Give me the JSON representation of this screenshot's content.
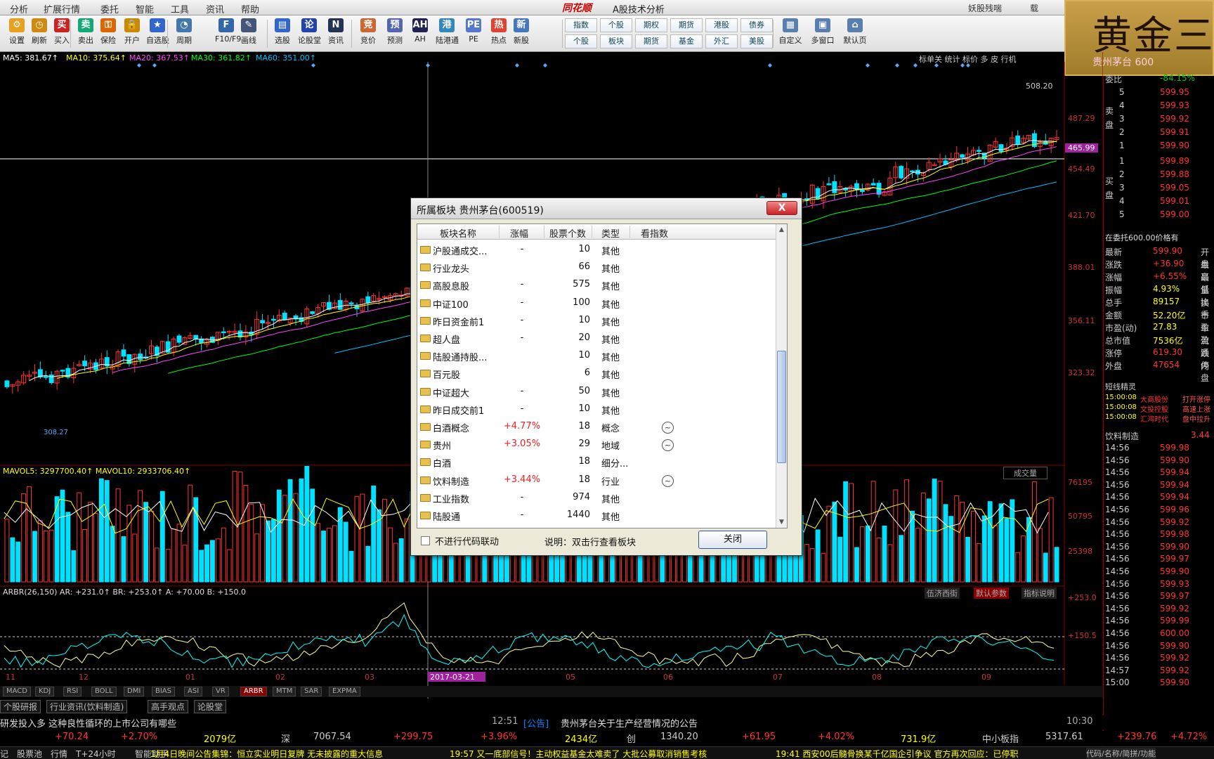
{
  "menu": {
    "items": [
      "分析",
      "扩展行情",
      "委托",
      "智能",
      "工具",
      "资讯",
      "帮助"
    ],
    "brand": "同花顺",
    "app_title": "A股技术分析",
    "right_items": [
      "妖股残喘",
      "载"
    ]
  },
  "toolbar": {
    "buttons": [
      {
        "label": "设置",
        "icon": "gear-icon"
      },
      {
        "label": "刷新",
        "icon": "clock-icon"
      },
      {
        "label": "买入",
        "icon": "buy-icon"
      },
      {
        "label": "卖出",
        "icon": "sell-icon"
      },
      {
        "label": "保险",
        "icon": "key-icon"
      },
      {
        "label": "开户",
        "icon": "lock-icon"
      },
      {
        "label": "自选股",
        "icon": "star-icon"
      },
      {
        "label": "周期",
        "icon": "period-icon"
      },
      {
        "label": "F10/F9",
        "icon": "f10-icon"
      },
      {
        "label": "画线",
        "icon": "pen-icon"
      },
      {
        "label": "选股",
        "icon": "chart-icon"
      },
      {
        "label": "论股堂",
        "icon": "talk-icon"
      },
      {
        "label": "资讯",
        "icon": "news-icon"
      },
      {
        "label": "竞价",
        "icon": "bid-icon"
      },
      {
        "label": "预测",
        "icon": "forecast-icon"
      },
      {
        "label": "AH",
        "icon": "ah-icon"
      },
      {
        "label": "陆港通",
        "icon": "hk-connect-icon"
      },
      {
        "label": "PE",
        "icon": "pe-icon"
      },
      {
        "label": "热点",
        "icon": "hot-icon"
      },
      {
        "label": "新股",
        "icon": "new-stock-icon"
      }
    ],
    "grid_buttons": [
      {
        "top": "指数",
        "bottom": "个股"
      },
      {
        "top": "个股",
        "bottom": "板块"
      },
      {
        "top": "期权",
        "bottom": "期货"
      },
      {
        "top": "期货",
        "bottom": "基金"
      },
      {
        "top": "港股",
        "bottom": "外汇"
      },
      {
        "top": "债券",
        "bottom": "美股"
      }
    ],
    "right_buttons": [
      {
        "label": "自定义",
        "icon": "custom-icon"
      },
      {
        "label": "多窗口",
        "icon": "window-icon"
      },
      {
        "label": "默认页",
        "icon": "home-icon"
      }
    ]
  },
  "gold_overlay": {
    "title": "黄金三",
    "sub": "贵州茅台 600"
  },
  "chart": {
    "ma_labels": [
      {
        "text": "MA5: 381.67↑",
        "color": "#ffffff"
      },
      {
        "text": "MA10: 375.64↑",
        "color": "#ffff00"
      },
      {
        "text": "MA20: 367.53↑",
        "color": "#ff44ff"
      },
      {
        "text": "MA30: 361.82↑",
        "color": "#00ff00"
      },
      {
        "text": "MA60: 351.00↑",
        "color": "#00c0ff"
      }
    ],
    "vol_label": "MAVOL5: 3297700.40↑  MAVOL10: 2933706.40↑",
    "arbr_label": "ARBR(26,150) AR: +231.0↑  BR: +253.0↑  A: +70.00  B: +150.0",
    "price_axis": [
      "508.20",
      "487.29",
      "465.99",
      "454.49",
      "421.70",
      "388.01",
      "356.11",
      "323.32"
    ],
    "vol_axis": [
      "76195",
      "50795",
      "25398"
    ],
    "arbr_axis": [
      "+253.0",
      "+150.5"
    ],
    "date_labels": [
      "11",
      "12",
      "01",
      "02",
      "03",
      "04",
      "05",
      "06",
      "07",
      "08",
      "09"
    ],
    "date_highlight": "2017-03-21",
    "low_label": "308.27",
    "right_top_menu": "标单关 统计 标价 多 皮 行机",
    "vol_switch": "成交量",
    "arbr_buttons": [
      "伍济西街",
      "默认参数",
      "指标说明"
    ]
  },
  "quote": {
    "header": {
      "label": "委比",
      "value": "-84.15%"
    },
    "sell": [
      {
        "n": "5",
        "p": "599.95"
      },
      {
        "n": "4",
        "p": "599.93"
      },
      {
        "n": "3",
        "p": "599.92"
      },
      {
        "n": "2",
        "p": "599.91"
      },
      {
        "n": "1",
        "p": "599.90"
      }
    ],
    "buy": [
      {
        "n": "1",
        "p": "599.89"
      },
      {
        "n": "2",
        "p": "599.88"
      },
      {
        "n": "3",
        "p": "599.05"
      },
      {
        "n": "4",
        "p": "599.01"
      },
      {
        "n": "5",
        "p": "599.00"
      }
    ],
    "sell_label": "卖盘",
    "buy_label": "买盘",
    "note_line": "在委托600.00价格有",
    "stats": [
      {
        "k": "最新",
        "v": "599.90",
        "k2": "开盘"
      },
      {
        "k": "涨跌",
        "v": "+36.90",
        "k2": "最高"
      },
      {
        "k": "涨幅",
        "v": "+6.55%",
        "k2": "最低"
      },
      {
        "k": "振幅",
        "v": "4.93%",
        "k2": "量比"
      },
      {
        "k": "总手",
        "v": "89157",
        "k2": "换手"
      },
      {
        "k": "金额",
        "v": "52.20亿",
        "k2": "市盈"
      },
      {
        "k": "市盈(动)",
        "v": "27.83",
        "k2": "市盈"
      },
      {
        "k": "总市值",
        "v": "7536亿",
        "k2": "流通"
      },
      {
        "k": "涨停",
        "v": "619.30",
        "k2": "跌停"
      },
      {
        "k": "外盘",
        "v": "47654",
        "k2": "内盘"
      }
    ],
    "news_title": "短线精灵",
    "news": [
      {
        "t": "15:00:08",
        "x": "大商股份",
        "y": "打开涨停"
      },
      {
        "t": "15:00:08",
        "x": "文投控股",
        "y": "高速上涨"
      },
      {
        "t": "15:00:08",
        "x": "汇鸿时代",
        "y": "盘中拉升"
      }
    ],
    "sector": {
      "name": "饮料制造",
      "value": "3.44"
    },
    "ticks": [
      {
        "t": "14:56",
        "p": "599.98"
      },
      {
        "t": "14:56",
        "p": "599.90"
      },
      {
        "t": "14:56",
        "p": "599.94"
      },
      {
        "t": "14:56",
        "p": "599.94"
      },
      {
        "t": "14:56",
        "p": "599.94"
      },
      {
        "t": "14:56",
        "p": "599.96"
      },
      {
        "t": "14:56",
        "p": "599.92"
      },
      {
        "t": "14:56",
        "p": "599.98"
      },
      {
        "t": "14:56",
        "p": "599.90"
      },
      {
        "t": "14:56",
        "p": "599.97"
      },
      {
        "t": "14:56",
        "p": "599.90"
      },
      {
        "t": "14:56",
        "p": "599.93"
      },
      {
        "t": "14:56",
        "p": "599.97"
      },
      {
        "t": "14:56",
        "p": "599.92"
      },
      {
        "t": "14:56",
        "p": "599.99"
      },
      {
        "t": "14:56",
        "p": "600.00"
      },
      {
        "t": "14:56",
        "p": "599.90"
      },
      {
        "t": "14:56",
        "p": "599.92"
      },
      {
        "t": "14:57",
        "p": "599.92"
      },
      {
        "t": "15:00",
        "p": "599.90"
      }
    ]
  },
  "dialog": {
    "title": "所属板块 贵州茅台(600519)",
    "columns": [
      "板块名称",
      "涨幅",
      "股票个数",
      "类型",
      "看指数"
    ],
    "rows": [
      {
        "name": "沪股通成交...",
        "pct": "-",
        "count": "10",
        "type": "其他",
        "idx": false
      },
      {
        "name": "行业龙头",
        "pct": "",
        "count": "66",
        "type": "其他",
        "idx": false
      },
      {
        "name": "高股息股",
        "pct": "-",
        "count": "575",
        "type": "其他",
        "idx": false
      },
      {
        "name": "中证100",
        "pct": "-",
        "count": "100",
        "type": "其他",
        "idx": false
      },
      {
        "name": "昨日资金前1",
        "pct": "-",
        "count": "10",
        "type": "其他",
        "idx": false
      },
      {
        "name": "超人盘",
        "pct": "-",
        "count": "20",
        "type": "其他",
        "idx": false
      },
      {
        "name": "陆股通持股...",
        "pct": "",
        "count": "10",
        "type": "其他",
        "idx": false
      },
      {
        "name": "百元股",
        "pct": "",
        "count": "6",
        "type": "其他",
        "idx": false
      },
      {
        "name": "中证超大",
        "pct": "-",
        "count": "50",
        "type": "其他",
        "idx": false
      },
      {
        "name": "昨日成交前1",
        "pct": "-",
        "count": "10",
        "type": "其他",
        "idx": false
      },
      {
        "name": "白酒概念",
        "pct": "+4.77%",
        "count": "18",
        "type": "概念",
        "idx": true
      },
      {
        "name": "贵州",
        "pct": "+3.05%",
        "count": "29",
        "type": "地域",
        "idx": true
      },
      {
        "name": "白酒",
        "pct": "",
        "count": "18",
        "type": "细分...",
        "idx": false
      },
      {
        "name": "饮料制造",
        "pct": "+3.44%",
        "count": "18",
        "type": "行业",
        "idx": true
      },
      {
        "name": "工业指数",
        "pct": "-",
        "count": "974",
        "type": "其他",
        "idx": false
      },
      {
        "name": "陆股通",
        "pct": "-",
        "count": "1440",
        "type": "其他",
        "idx": false
      }
    ],
    "checkbox_label": "不进行代码联动",
    "note": "说明：双击行查看板块",
    "close_button": "关闭",
    "close_x": "X"
  },
  "tabs": [
    "MACD",
    "KDJ",
    "RSI",
    "BOLL",
    "DMI",
    "BIAS",
    "ASI",
    "VR",
    "ARBR",
    "MTM",
    "SAR",
    "EXPMA"
  ],
  "tabs_active": "ARBR",
  "links": [
    "个股研报",
    "行业资讯(饮料制造)",
    "高手观点",
    "论股堂"
  ],
  "news_bar": {
    "left": "研发投入多 这种良性循环的上市公司有哪些",
    "time": "12:51",
    "tag": "[公告]",
    "text": "贵州茅台关于生产经营情况的公告",
    "right_time": "10:30"
  },
  "index_bar": [
    {
      "t": "+70.24",
      "c": "#f33"
    },
    {
      "t": "+2.70%",
      "c": "#f33"
    },
    {
      "t": "2079亿",
      "c": "#ff0"
    },
    {
      "t": "深",
      "c": "#ccc"
    },
    {
      "t": "7067.54",
      "c": "#ccc"
    },
    {
      "t": "+299.75",
      "c": "#f33"
    },
    {
      "t": "+3.96%",
      "c": "#f33"
    },
    {
      "t": "2434亿",
      "c": "#ff0"
    },
    {
      "t": "创",
      "c": "#ccc"
    },
    {
      "t": "1340.20",
      "c": "#ccc"
    },
    {
      "t": "+61.95",
      "c": "#f33"
    },
    {
      "t": "+4.02%",
      "c": "#f33"
    },
    {
      "t": "731.9亿",
      "c": "#ff0"
    },
    {
      "t": "中小板指",
      "c": "#ccc"
    },
    {
      "t": "5317.61",
      "c": "#ccc"
    },
    {
      "t": "+239.76",
      "c": "#f33"
    },
    {
      "t": "+4.72%",
      "c": "#f33"
    }
  ],
  "status_bar": {
    "items": [
      "记",
      "股票池",
      "行情",
      "T+24小时",
      "智能助手"
    ],
    "news1": "1月4日晚间公告集锦：恒立实业明日复牌 无未披露的重大信息",
    "news2": "19:57 又一底部信号！主动权益基金太难卖了 大批公募取消销售考核",
    "news3": "19:41 西安00后髓骨换某千亿国企引争议 官方再次回应：已停职",
    "right": "代码/名称/简拼/功能"
  },
  "colors": {
    "up": "#ff3333",
    "down": "#00e0ff",
    "grid": "#800000",
    "panel_bg": "#000000"
  }
}
